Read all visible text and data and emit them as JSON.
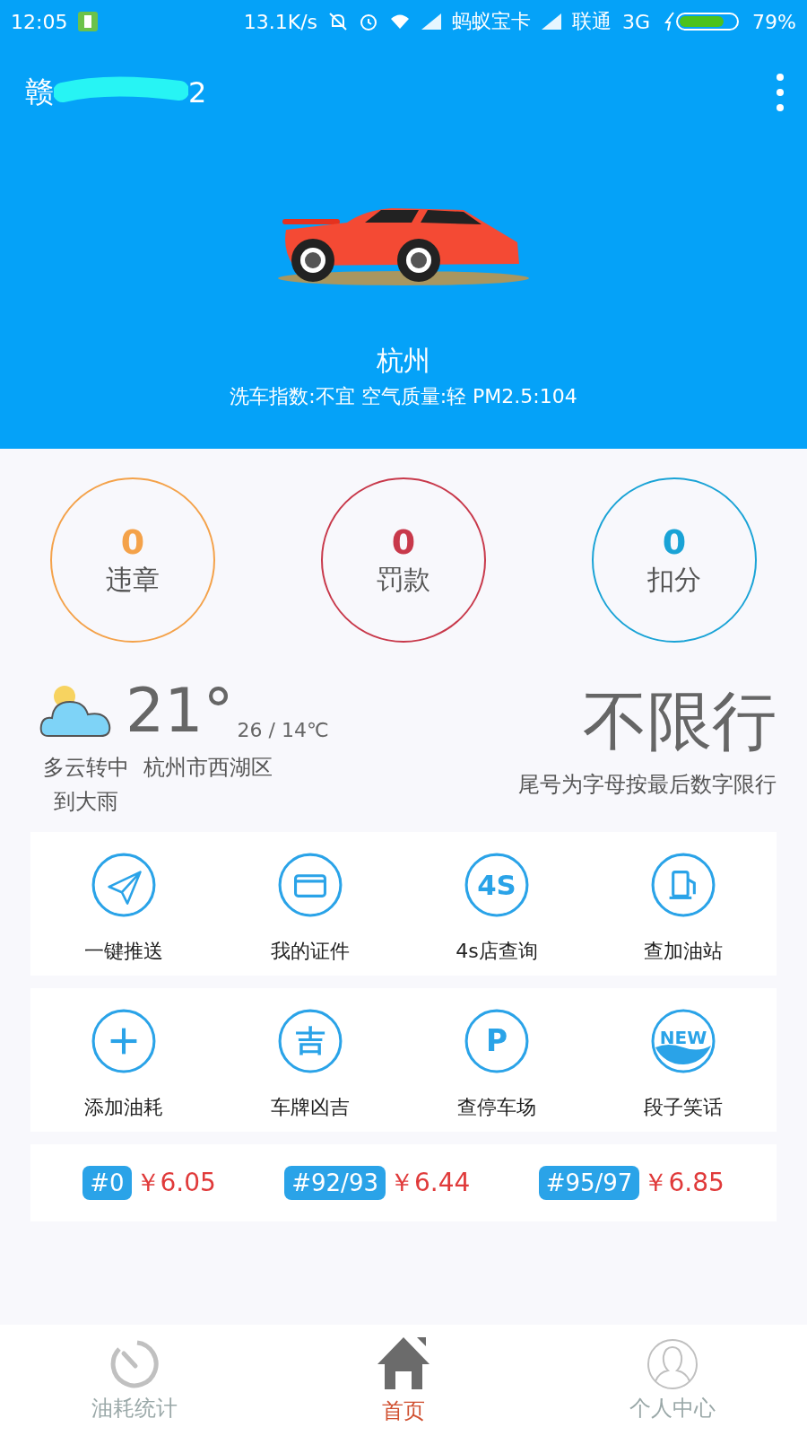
{
  "status_bar": {
    "time": "12:05",
    "speed": "13.1K/s",
    "carriers": [
      "蚂蚁宝卡",
      "联通"
    ],
    "network": "3G",
    "battery": {
      "text": "79%",
      "level": 0.79
    }
  },
  "header": {
    "title_start": "赣",
    "title_end": "2",
    "city": "杭州",
    "conditions": "洗车指数:不宜 空气质量:轻 PM2.5:104"
  },
  "stats": [
    {
      "value": "0",
      "label": "违章",
      "color": "#f4a24a"
    },
    {
      "value": "0",
      "label": "罚款",
      "color": "#c8394b"
    },
    {
      "value": "0",
      "label": "扣分",
      "color": "#1aa3d6"
    }
  ],
  "weather": {
    "temperature": "21°",
    "range": "26 / 14℃",
    "description": "多云转中到大雨",
    "location": "杭州市西湖区"
  },
  "restriction": {
    "status": "不限行",
    "note": "尾号为字母按最后数字限行"
  },
  "shortcut_rows": [
    [
      {
        "label": "一键推送",
        "kind": "send"
      },
      {
        "label": "我的证件",
        "kind": "card"
      },
      {
        "label": "4s店查询",
        "kind": "text",
        "icon_text": "4S"
      },
      {
        "label": "查加油站",
        "kind": "fuel"
      }
    ],
    [
      {
        "label": "添加油耗",
        "kind": "add"
      },
      {
        "label": "车牌凶吉",
        "kind": "text",
        "icon_text": "吉"
      },
      {
        "label": "查停车场",
        "kind": "text",
        "icon_text": "P"
      },
      {
        "label": "段子笑话",
        "kind": "new",
        "icon_text": "NEW"
      }
    ]
  ],
  "fuel_prices": [
    {
      "grade": "#0",
      "price": "￥6.05"
    },
    {
      "grade": "#92/93",
      "price": "￥6.44"
    },
    {
      "grade": "#95/97",
      "price": "￥6.85"
    }
  ],
  "nav": [
    {
      "label": "油耗统计",
      "kind": "gauge",
      "selected": false
    },
    {
      "label": "首页",
      "kind": "home",
      "selected": true
    },
    {
      "label": "个人中心",
      "kind": "person",
      "selected": false
    }
  ]
}
